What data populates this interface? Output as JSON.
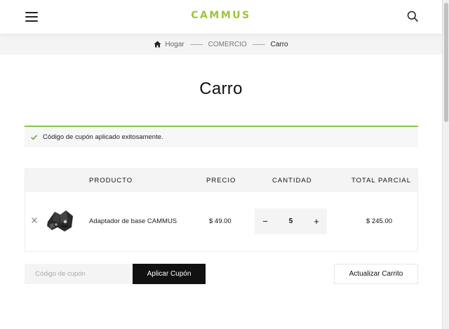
{
  "header": {
    "logo_text": "CAMMUS",
    "accent_color": "#9cc536"
  },
  "breadcrumb": {
    "home": "Hogar",
    "section": "COMERCIO",
    "current": "Carro"
  },
  "page_title": "Carro",
  "notice": {
    "message": "Código de cupón aplicado exitosamente.",
    "color": "#8bc34a"
  },
  "cart": {
    "columns": {
      "product": "PRODUCTO",
      "price": "PRECIO",
      "quantity": "CANTIDAD",
      "subtotal": "TOTAL PARCIAL"
    },
    "items": [
      {
        "name": "Adaptador de base CAMMUS",
        "price": "$ 49.00",
        "quantity": "5",
        "subtotal": "$ 245.00",
        "decrement": "−",
        "increment": "+"
      }
    ]
  },
  "coupon": {
    "placeholder": "Código de cupón",
    "apply_label": "Aplicar Cupón"
  },
  "update_label": "Actualizar Carrito"
}
